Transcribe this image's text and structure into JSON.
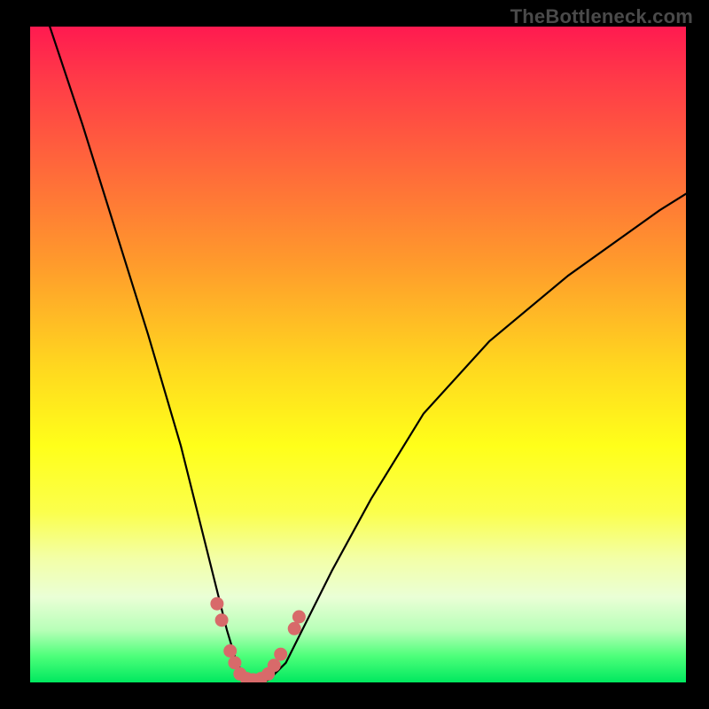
{
  "watermark": "TheBottleneck.com",
  "chart_data": {
    "type": "line",
    "title": "",
    "xlabel": "",
    "ylabel": "",
    "xlim": [
      0,
      100
    ],
    "ylim": [
      0,
      100
    ],
    "grid": false,
    "legend": false,
    "series": [
      {
        "name": "curve",
        "x": [
          3,
          8,
          13,
          18,
          23,
          26,
          28,
          30,
          31.5,
          33,
          34.5,
          35.5,
          36.5,
          39,
          42,
          46,
          52,
          60,
          70,
          82,
          96,
          100
        ],
        "y": [
          100,
          85,
          69,
          53,
          36,
          24,
          16,
          8,
          3,
          0.5,
          0,
          0,
          0.5,
          3,
          9,
          17,
          28,
          41,
          52,
          62,
          72,
          74.5
        ]
      }
    ],
    "markers": {
      "name": "highlight-dots",
      "color": "#d86a6a",
      "points": [
        {
          "x": 28.5,
          "y": 12.0
        },
        {
          "x": 29.2,
          "y": 9.5
        },
        {
          "x": 30.5,
          "y": 4.8
        },
        {
          "x": 31.2,
          "y": 3.0
        },
        {
          "x": 32.0,
          "y": 1.3
        },
        {
          "x": 33.0,
          "y": 0.6
        },
        {
          "x": 34.0,
          "y": 0.4
        },
        {
          "x": 35.2,
          "y": 0.6
        },
        {
          "x": 36.3,
          "y": 1.3
        },
        {
          "x": 37.2,
          "y": 2.6
        },
        {
          "x": 38.2,
          "y": 4.3
        },
        {
          "x": 40.3,
          "y": 8.2
        },
        {
          "x": 41.0,
          "y": 10.0
        }
      ]
    },
    "background_gradient": {
      "stops": [
        {
          "pos": 0.0,
          "color": "#ff1a50"
        },
        {
          "pos": 0.36,
          "color": "#ff9a2c"
        },
        {
          "pos": 0.64,
          "color": "#ffff1a"
        },
        {
          "pos": 0.92,
          "color": "#b8ffb8"
        },
        {
          "pos": 1.0,
          "color": "#00e85f"
        }
      ]
    }
  }
}
